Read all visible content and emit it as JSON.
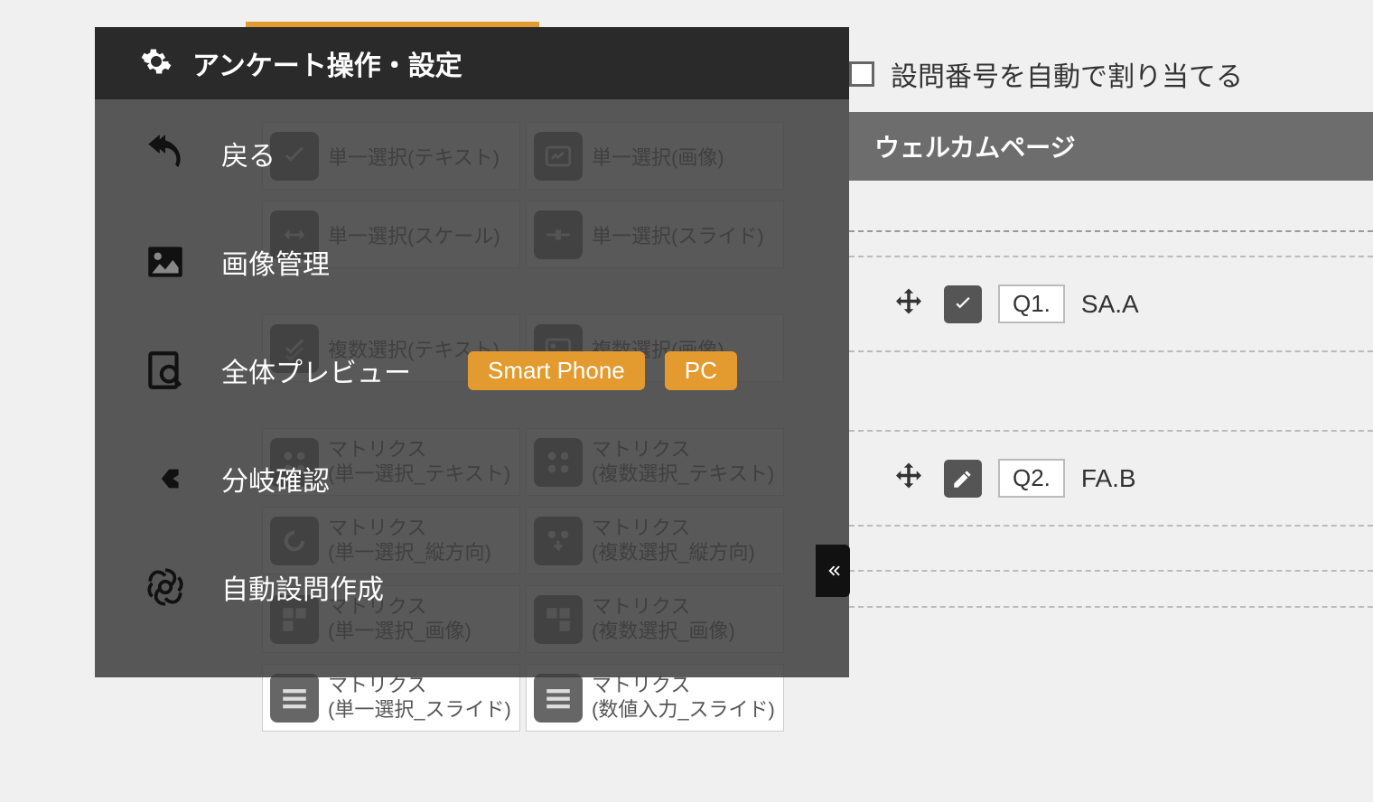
{
  "overlay": {
    "title": "アンケート操作・設定",
    "menu": {
      "back": "戻る",
      "image_mgmt": "画像管理",
      "preview": "全体プレビュー",
      "preview_sp": "Smart Phone",
      "preview_pc": "PC",
      "branch": "分岐確認",
      "auto_q": "自動設問作成"
    }
  },
  "tiles": {
    "r1a": "単一選択(テキスト)",
    "r1b": "単一選択(画像)",
    "r2a": "単一選択(スケール)",
    "r2b": "単一選択(スライド)",
    "r3a": "複数選択(テキスト)",
    "r3b": "複数選択(画像)",
    "r4a1": "マトリクス",
    "r4a2": "(単一選択_テキスト)",
    "r4b1": "マトリクス",
    "r4b2": "(複数選択_テキスト)",
    "r5a1": "マトリクス",
    "r5a2": "(単一選択_縦方向)",
    "r5b1": "マトリクス",
    "r5b2": "(複数選択_縦方向)",
    "r6a1": "マトリクス",
    "r6a2": "(単一選択_画像)",
    "r6b1": "マトリクス",
    "r6b2": "(複数選択_画像)",
    "r7a1": "マトリクス",
    "r7a2": "(単一選択_スライド)",
    "r7b1": "マトリクス",
    "r7b2": "(数値入力_スライド)"
  },
  "right": {
    "auto_number": "設問番号を自動で割り当てる",
    "welcome": "ウェルカムページ",
    "q1_num": "Q1.",
    "q1_label": "SA.A",
    "q2_num": "Q2.",
    "q2_label": "FA.B"
  }
}
